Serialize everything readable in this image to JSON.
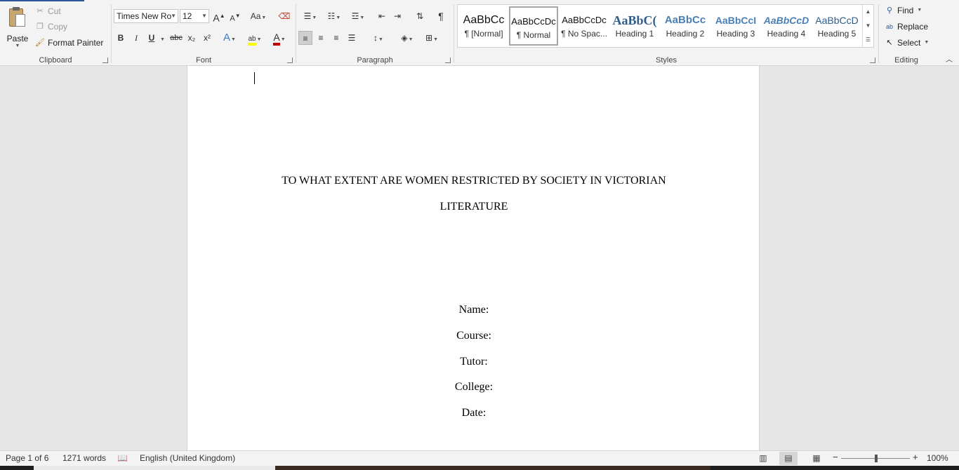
{
  "clipboard": {
    "paste_label": "Paste",
    "cut_label": "Cut",
    "copy_label": "Copy",
    "format_painter_label": "Format Painter",
    "group_label": "Clipboard"
  },
  "font": {
    "family": "Times New Ro",
    "size": "12",
    "grow_label": "A",
    "shrink_label": "A",
    "change_case_label": "Aa",
    "bold_label": "B",
    "italic_label": "I",
    "underline_label": "U",
    "strike_label": "abc",
    "subscript_label": "x₂",
    "superscript_label": "x²",
    "group_label": "Font"
  },
  "paragraph": {
    "group_label": "Paragraph"
  },
  "styles": {
    "group_label": "Styles",
    "items": [
      {
        "sample": "AaBbCc",
        "name": "¶ [Normal]"
      },
      {
        "sample": "AaBbCcDc",
        "name": "¶ Normal"
      },
      {
        "sample": "AaBbCcDc",
        "name": "¶ No Spac..."
      },
      {
        "sample": "AaBbC(",
        "name": "Heading 1"
      },
      {
        "sample": "AaBbCc",
        "name": "Heading 2"
      },
      {
        "sample": "AaBbCcI",
        "name": "Heading 3"
      },
      {
        "sample": "AaBbCcD",
        "name": "Heading 4"
      },
      {
        "sample": "AaBbCcD",
        "name": "Heading 5"
      }
    ]
  },
  "editing": {
    "find_label": "Find",
    "replace_label": "Replace",
    "select_label": "Select",
    "group_label": "Editing"
  },
  "document": {
    "title_line1": "TO WHAT EXTENT ARE WOMEN RESTRICTED BY SOCIETY IN VICTORIAN",
    "title_line2": "LITERATURE",
    "fields": [
      "Name:",
      "Course:",
      "Tutor:",
      "College:",
      "Date:"
    ]
  },
  "status": {
    "page": "Page 1 of 6",
    "words": "1271 words",
    "language": "English (United Kingdom)",
    "zoom": "100%"
  },
  "colors": {
    "accent": "#2b579a",
    "highlight": "#ffff00",
    "font_color": "#c00000"
  }
}
